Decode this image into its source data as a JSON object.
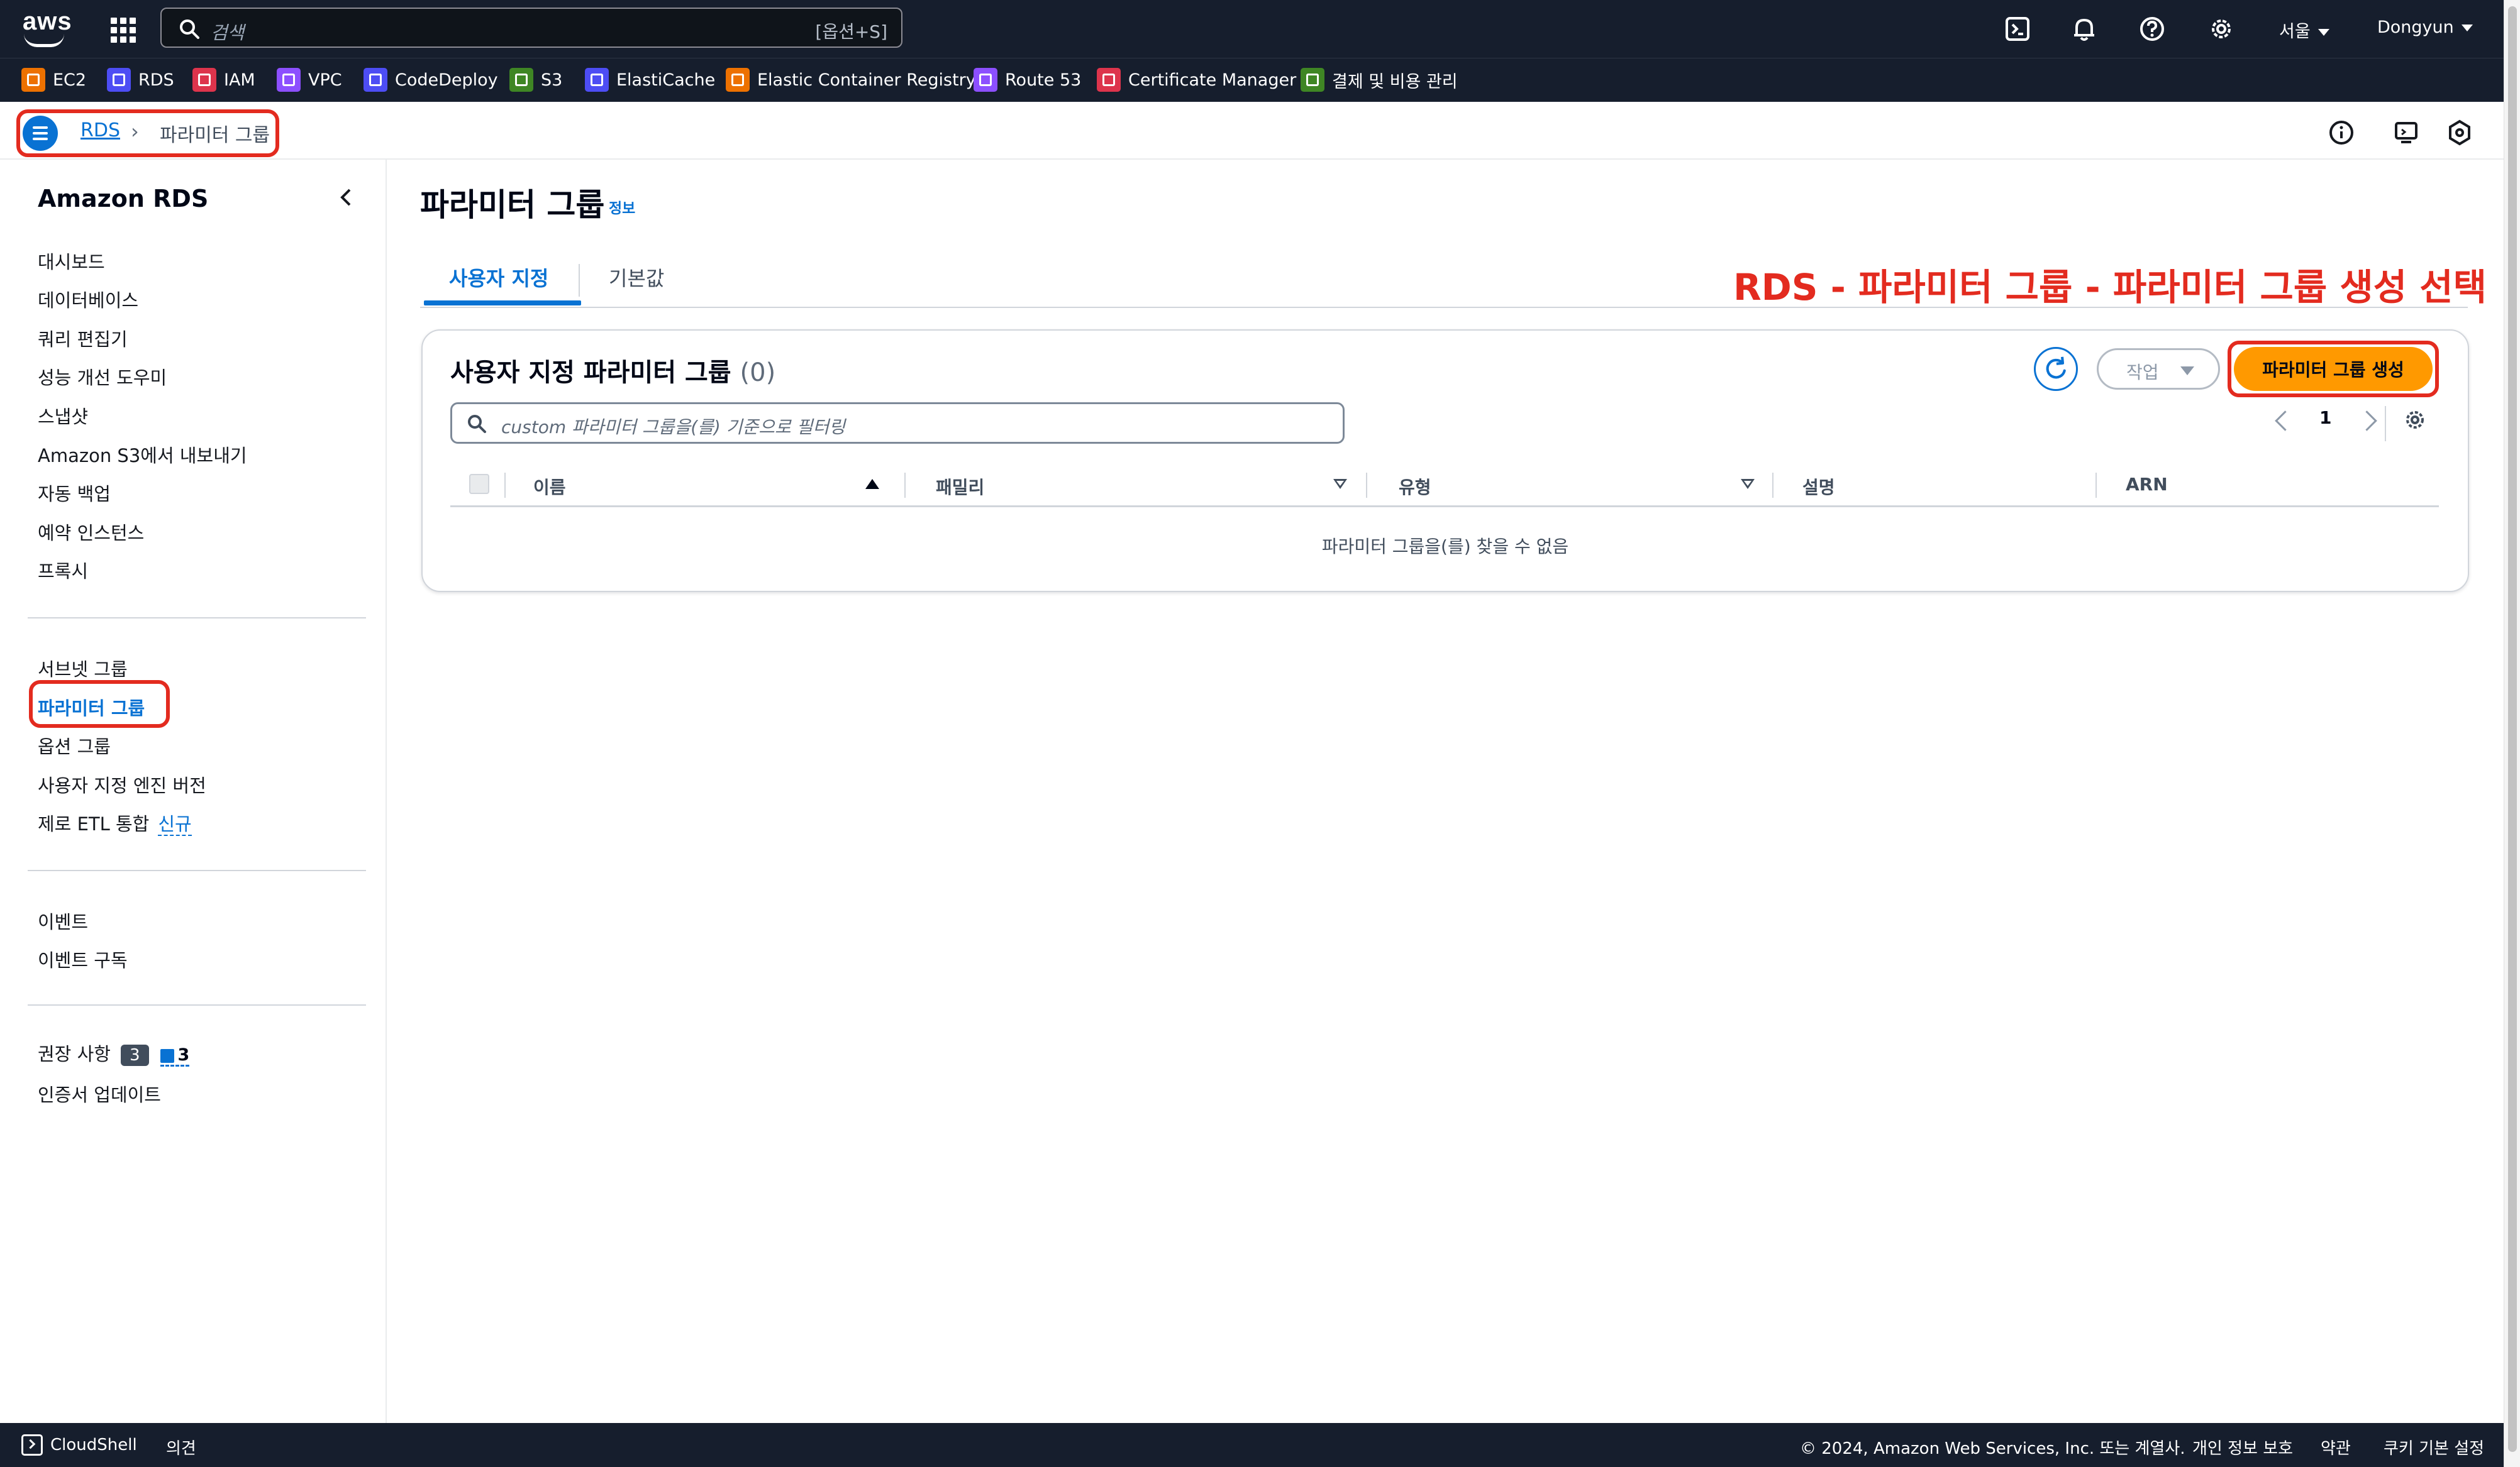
{
  "colors": {
    "nav_bg": "#161e2d",
    "link_blue": "#0972d3",
    "primary_orange": "#ff9900",
    "annotation_red": "#e32b1f"
  },
  "topnav": {
    "logo_text": "aws",
    "search_placeholder": "검색",
    "search_shortcut": "[옵션+S]",
    "region": "서울",
    "user": "Dongyun",
    "icons": [
      "apps-grid-icon",
      "cloudshell-icon",
      "bell-icon",
      "help-icon",
      "settings-icon"
    ]
  },
  "favorites": [
    {
      "label": "EC2",
      "color": "#ed7100"
    },
    {
      "label": "RDS",
      "color": "#4d4df4"
    },
    {
      "label": "IAM",
      "color": "#dd344c"
    },
    {
      "label": "VPC",
      "color": "#8c4fff"
    },
    {
      "label": "CodeDeploy",
      "color": "#4d4df4"
    },
    {
      "label": "S3",
      "color": "#3f8624"
    },
    {
      "label": "ElastiCache",
      "color": "#4d4df4"
    },
    {
      "label": "Elastic Container Registry",
      "color": "#ed7100"
    },
    {
      "label": "Route 53",
      "color": "#8c4fff"
    },
    {
      "label": "Certificate Manager",
      "color": "#dd344c"
    },
    {
      "label": "결제 및 비용 관리",
      "color": "#3f8624"
    }
  ],
  "breadcrumb": {
    "root": "RDS",
    "separator": "›",
    "current": "파라미터 그룹"
  },
  "sidebar": {
    "title": "Amazon RDS",
    "group1": [
      "대시보드",
      "데이터베이스",
      "쿼리 편집기",
      "성능 개선 도우미",
      "스냅샷",
      "Amazon S3에서 내보내기",
      "자동 백업",
      "예약 인스턴스",
      "프록시"
    ],
    "group2": [
      "서브넷 그룹",
      "파라미터 그룹",
      "옵션 그룹",
      "사용자 지정 엔진 버전"
    ],
    "zero_etl": "제로 ETL 통합",
    "zero_etl_tag": "신규",
    "group3": [
      "이벤트",
      "이벤트 구독"
    ],
    "recommendations": "권장 사항",
    "rec_badge_dark": "3",
    "rec_badge_blue": "3",
    "cert_update": "인증서 업데이트",
    "active_item": "파라미터 그룹"
  },
  "main": {
    "title": "파라미터 그룹",
    "info": "정보",
    "tabs": [
      "사용자 지정",
      "기본값"
    ],
    "annotation": "RDS - 파라미터 그룹 - 파라미터 그룹 생성 선택",
    "panel": {
      "title": "사용자 지정 파라미터 그룹",
      "count": "(0)",
      "actions_label": "작업",
      "create_label": "파라미터 그룹 생성",
      "filter_placeholder": "custom 파라미터 그룹을(를) 기준으로 필터링",
      "page": "1",
      "columns": [
        "이름",
        "패밀리",
        "유형",
        "설명",
        "ARN"
      ],
      "empty_message": "파라미터 그룹을(를) 찾을 수 없음"
    }
  },
  "footer": {
    "cloudshell": "CloudShell",
    "feedback": "의견",
    "copyright": "© 2024, Amazon Web Services, Inc. 또는 계열사.",
    "privacy": "개인 정보 보호",
    "terms": "약관",
    "cookies": "쿠키 기본 설정"
  }
}
